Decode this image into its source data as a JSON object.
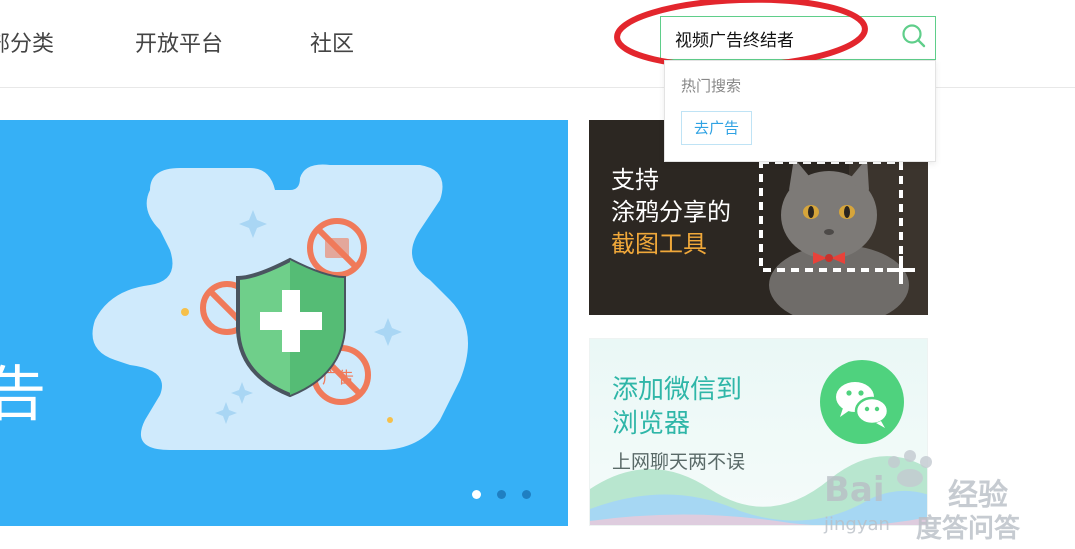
{
  "nav": {
    "items": [
      {
        "label": "部分类"
      },
      {
        "label": "开放平台"
      },
      {
        "label": "社区"
      }
    ]
  },
  "search": {
    "value": "视频广告终结者",
    "icon": "search-icon",
    "border_color": "#5fce8a"
  },
  "suggest": {
    "label": "热门搜索",
    "tags": [
      "去广告"
    ]
  },
  "annotation": {
    "color": "#e3262d"
  },
  "banner": {
    "bg_color": "#36b0f6",
    "partial_text": "告",
    "slides_total": 3,
    "active_slide": 1
  },
  "promo_screenshot": {
    "line1": "支持",
    "line2": "涂鸦分享的",
    "highlight": "截图工具"
  },
  "promo_wechat": {
    "line1": "添加微信到",
    "line2": "浏览器",
    "subtitle": "上网聊天两不误"
  },
  "watermark": {
    "brand": "Bai",
    "brand_suffix": "经验",
    "sub": "jingyan",
    "sub_suffix": "度答问答"
  }
}
